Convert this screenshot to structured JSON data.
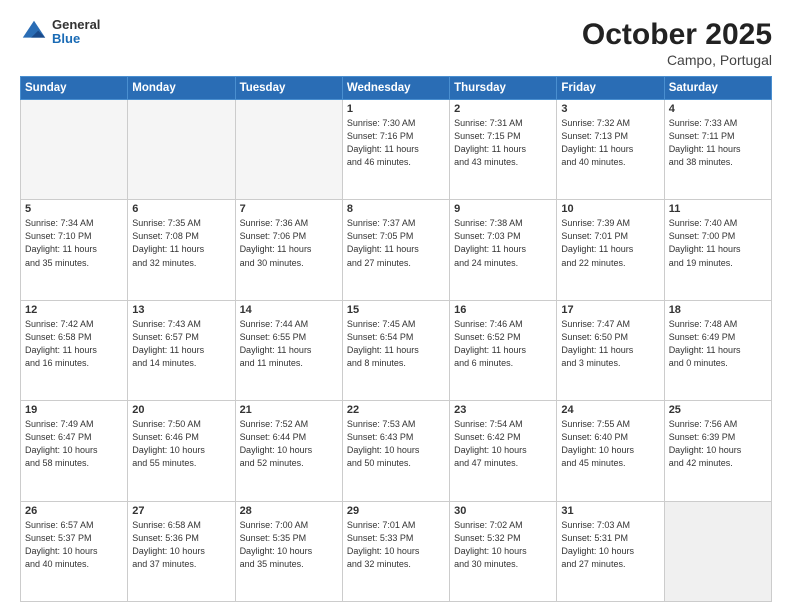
{
  "header": {
    "logo_general": "General",
    "logo_blue": "Blue",
    "month_title": "October 2025",
    "location": "Campo, Portugal"
  },
  "weekdays": [
    "Sunday",
    "Monday",
    "Tuesday",
    "Wednesday",
    "Thursday",
    "Friday",
    "Saturday"
  ],
  "weeks": [
    [
      {
        "day": "",
        "info": "",
        "empty": true
      },
      {
        "day": "",
        "info": "",
        "empty": true
      },
      {
        "day": "",
        "info": "",
        "empty": true
      },
      {
        "day": "1",
        "info": "Sunrise: 7:30 AM\nSunset: 7:16 PM\nDaylight: 11 hours\nand 46 minutes."
      },
      {
        "day": "2",
        "info": "Sunrise: 7:31 AM\nSunset: 7:15 PM\nDaylight: 11 hours\nand 43 minutes."
      },
      {
        "day": "3",
        "info": "Sunrise: 7:32 AM\nSunset: 7:13 PM\nDaylight: 11 hours\nand 40 minutes."
      },
      {
        "day": "4",
        "info": "Sunrise: 7:33 AM\nSunset: 7:11 PM\nDaylight: 11 hours\nand 38 minutes."
      }
    ],
    [
      {
        "day": "5",
        "info": "Sunrise: 7:34 AM\nSunset: 7:10 PM\nDaylight: 11 hours\nand 35 minutes."
      },
      {
        "day": "6",
        "info": "Sunrise: 7:35 AM\nSunset: 7:08 PM\nDaylight: 11 hours\nand 32 minutes."
      },
      {
        "day": "7",
        "info": "Sunrise: 7:36 AM\nSunset: 7:06 PM\nDaylight: 11 hours\nand 30 minutes."
      },
      {
        "day": "8",
        "info": "Sunrise: 7:37 AM\nSunset: 7:05 PM\nDaylight: 11 hours\nand 27 minutes."
      },
      {
        "day": "9",
        "info": "Sunrise: 7:38 AM\nSunset: 7:03 PM\nDaylight: 11 hours\nand 24 minutes."
      },
      {
        "day": "10",
        "info": "Sunrise: 7:39 AM\nSunset: 7:01 PM\nDaylight: 11 hours\nand 22 minutes."
      },
      {
        "day": "11",
        "info": "Sunrise: 7:40 AM\nSunset: 7:00 PM\nDaylight: 11 hours\nand 19 minutes."
      }
    ],
    [
      {
        "day": "12",
        "info": "Sunrise: 7:42 AM\nSunset: 6:58 PM\nDaylight: 11 hours\nand 16 minutes."
      },
      {
        "day": "13",
        "info": "Sunrise: 7:43 AM\nSunset: 6:57 PM\nDaylight: 11 hours\nand 14 minutes."
      },
      {
        "day": "14",
        "info": "Sunrise: 7:44 AM\nSunset: 6:55 PM\nDaylight: 11 hours\nand 11 minutes."
      },
      {
        "day": "15",
        "info": "Sunrise: 7:45 AM\nSunset: 6:54 PM\nDaylight: 11 hours\nand 8 minutes."
      },
      {
        "day": "16",
        "info": "Sunrise: 7:46 AM\nSunset: 6:52 PM\nDaylight: 11 hours\nand 6 minutes."
      },
      {
        "day": "17",
        "info": "Sunrise: 7:47 AM\nSunset: 6:50 PM\nDaylight: 11 hours\nand 3 minutes."
      },
      {
        "day": "18",
        "info": "Sunrise: 7:48 AM\nSunset: 6:49 PM\nDaylight: 11 hours\nand 0 minutes."
      }
    ],
    [
      {
        "day": "19",
        "info": "Sunrise: 7:49 AM\nSunset: 6:47 PM\nDaylight: 10 hours\nand 58 minutes."
      },
      {
        "day": "20",
        "info": "Sunrise: 7:50 AM\nSunset: 6:46 PM\nDaylight: 10 hours\nand 55 minutes."
      },
      {
        "day": "21",
        "info": "Sunrise: 7:52 AM\nSunset: 6:44 PM\nDaylight: 10 hours\nand 52 minutes."
      },
      {
        "day": "22",
        "info": "Sunrise: 7:53 AM\nSunset: 6:43 PM\nDaylight: 10 hours\nand 50 minutes."
      },
      {
        "day": "23",
        "info": "Sunrise: 7:54 AM\nSunset: 6:42 PM\nDaylight: 10 hours\nand 47 minutes."
      },
      {
        "day": "24",
        "info": "Sunrise: 7:55 AM\nSunset: 6:40 PM\nDaylight: 10 hours\nand 45 minutes."
      },
      {
        "day": "25",
        "info": "Sunrise: 7:56 AM\nSunset: 6:39 PM\nDaylight: 10 hours\nand 42 minutes."
      }
    ],
    [
      {
        "day": "26",
        "info": "Sunrise: 6:57 AM\nSunset: 5:37 PM\nDaylight: 10 hours\nand 40 minutes."
      },
      {
        "day": "27",
        "info": "Sunrise: 6:58 AM\nSunset: 5:36 PM\nDaylight: 10 hours\nand 37 minutes."
      },
      {
        "day": "28",
        "info": "Sunrise: 7:00 AM\nSunset: 5:35 PM\nDaylight: 10 hours\nand 35 minutes."
      },
      {
        "day": "29",
        "info": "Sunrise: 7:01 AM\nSunset: 5:33 PM\nDaylight: 10 hours\nand 32 minutes."
      },
      {
        "day": "30",
        "info": "Sunrise: 7:02 AM\nSunset: 5:32 PM\nDaylight: 10 hours\nand 30 minutes."
      },
      {
        "day": "31",
        "info": "Sunrise: 7:03 AM\nSunset: 5:31 PM\nDaylight: 10 hours\nand 27 minutes."
      },
      {
        "day": "",
        "info": "",
        "empty": true
      }
    ]
  ]
}
